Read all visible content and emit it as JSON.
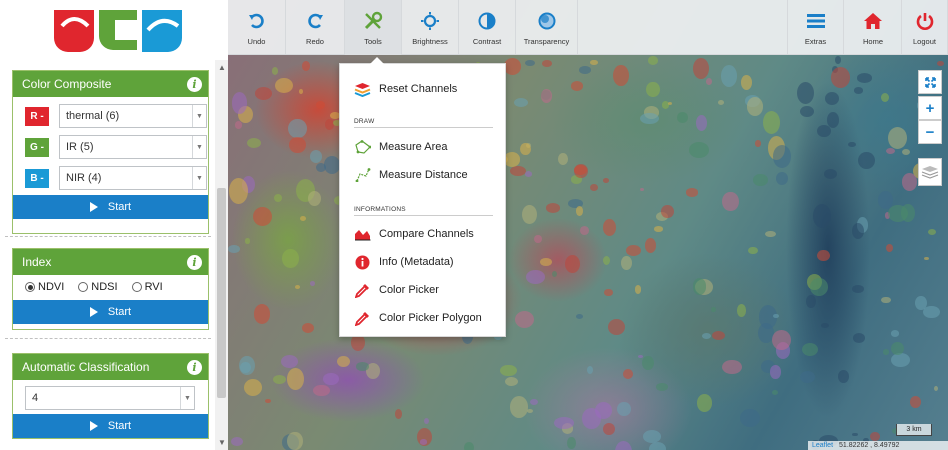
{
  "toolbar": {
    "left": [
      {
        "name": "undo-button",
        "label": "Undo",
        "icon": "undo-icon"
      },
      {
        "name": "redo-button",
        "label": "Redo",
        "icon": "redo-icon"
      },
      {
        "name": "tools-button",
        "label": "Tools",
        "icon": "tools-icon"
      },
      {
        "name": "brightness-button",
        "label": "Brightness",
        "icon": "brightness-icon"
      },
      {
        "name": "contrast-button",
        "label": "Contrast",
        "icon": "contrast-icon"
      },
      {
        "name": "transparency-button",
        "label": "Transparency",
        "icon": "transparency-icon"
      }
    ],
    "right": [
      {
        "name": "extras-button",
        "label": "Extras",
        "icon": "hamburger-icon"
      },
      {
        "name": "home-button",
        "label": "Home",
        "icon": "home-icon"
      },
      {
        "name": "logout-button",
        "label": "Logout",
        "icon": "power-icon"
      }
    ],
    "accent": "#1a7fc8",
    "danger": "#e0262e"
  },
  "sidebar": {
    "color_composite": {
      "title": "Color Composite",
      "channels": [
        {
          "tag": "R -",
          "value": "thermal (6)",
          "color": "#e0262e"
        },
        {
          "tag": "G -",
          "value": "IR (5)",
          "color": "#5fa33a"
        },
        {
          "tag": "B -",
          "value": "NIR (4)",
          "color": "#1a9ad6"
        }
      ],
      "start": "Start"
    },
    "index": {
      "title": "Index",
      "options": [
        {
          "label": "NDVI",
          "selected": true
        },
        {
          "label": "NDSI",
          "selected": false
        },
        {
          "label": "RVI",
          "selected": false
        }
      ],
      "start": "Start"
    },
    "auto_class": {
      "title": "Automatic Classification",
      "value": "4",
      "start": "Start"
    }
  },
  "tools_menu": {
    "reset": "Reset Channels",
    "draw_section": "DRAW",
    "draw_items": [
      "Measure Area",
      "Measure Distance"
    ],
    "info_section": "INFORMATIONS",
    "info_items": [
      "Compare Channels",
      "Info (Metadata)",
      "Color Picker",
      "Color Picker Polygon"
    ]
  },
  "map": {
    "scale": "3 km",
    "attribution": "Leaflet",
    "coordinates": "51.82262 , 8.49792"
  }
}
